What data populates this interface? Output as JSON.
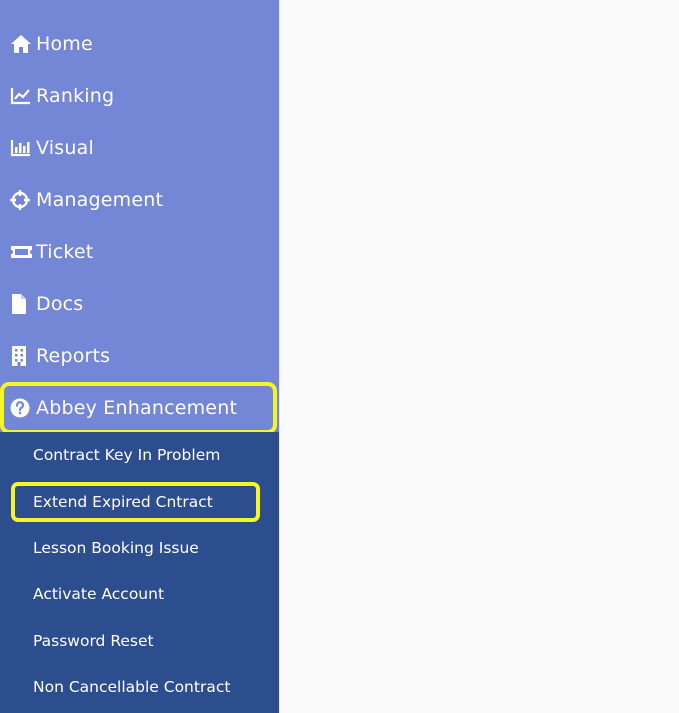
{
  "sidebar": {
    "items": [
      {
        "label": "Home",
        "icon": "home-icon"
      },
      {
        "label": "Ranking",
        "icon": "line-chart-icon"
      },
      {
        "label": "Visual",
        "icon": "bar-chart-icon"
      },
      {
        "label": "Management",
        "icon": "crosshair-icon"
      },
      {
        "label": "Ticket",
        "icon": "ticket-icon"
      },
      {
        "label": "Docs",
        "icon": "document-icon"
      },
      {
        "label": "Reports",
        "icon": "building-icon"
      },
      {
        "label": "Abbey Enhancement",
        "icon": "question-circle-icon"
      }
    ],
    "submenu": [
      {
        "label": "Contract Key In Problem"
      },
      {
        "label": "Extend Expired Cntract"
      },
      {
        "label": "Lesson Booking Issue"
      },
      {
        "label": "Activate Account"
      },
      {
        "label": "Password Reset"
      },
      {
        "label": "Non Cancellable Contract"
      }
    ]
  },
  "colors": {
    "sidebar_bg": "#7486d6",
    "submenu_bg": "#2c4e8e",
    "highlight": "#f5f528",
    "content_bg": "#fafafa"
  }
}
